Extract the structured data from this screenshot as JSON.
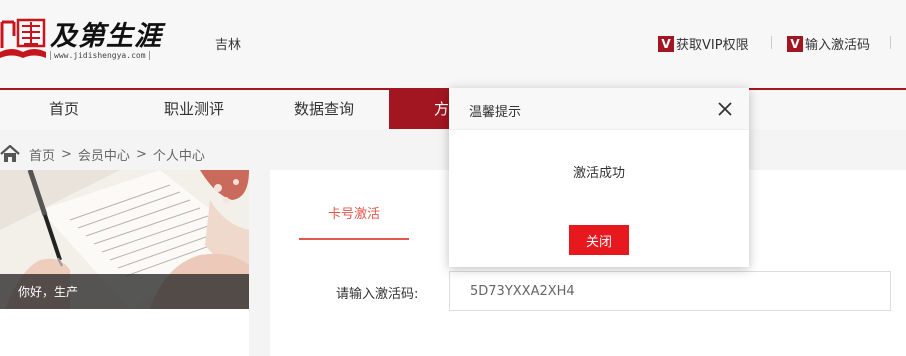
{
  "header": {
    "logo_name": "及第生涯",
    "logo_url": "www.jidishengya.com",
    "region": "吉林",
    "vip_badge": "V",
    "vip_link": "获取VIP权限",
    "activation_badge": "V",
    "activation_link": "输入激活码",
    "brand_color": "#a11621"
  },
  "nav": {
    "items": [
      "首页",
      "职业测评",
      "数据查询",
      "方案"
    ],
    "active_index": 3
  },
  "breadcrumb": {
    "items": [
      "首页",
      "会员中心",
      "个人中心"
    ],
    "separator": ">"
  },
  "sidebar": {
    "greeting": "你好，生产"
  },
  "main": {
    "tab_label": "卡号激活",
    "code_label": "请输入激活码:",
    "code_value": "5D73YXXA2XH4"
  },
  "modal": {
    "title": "温馨提示",
    "message": "激活成功",
    "close_button": "关闭",
    "close_icon": "close-icon",
    "button_color": "#e8191e"
  }
}
